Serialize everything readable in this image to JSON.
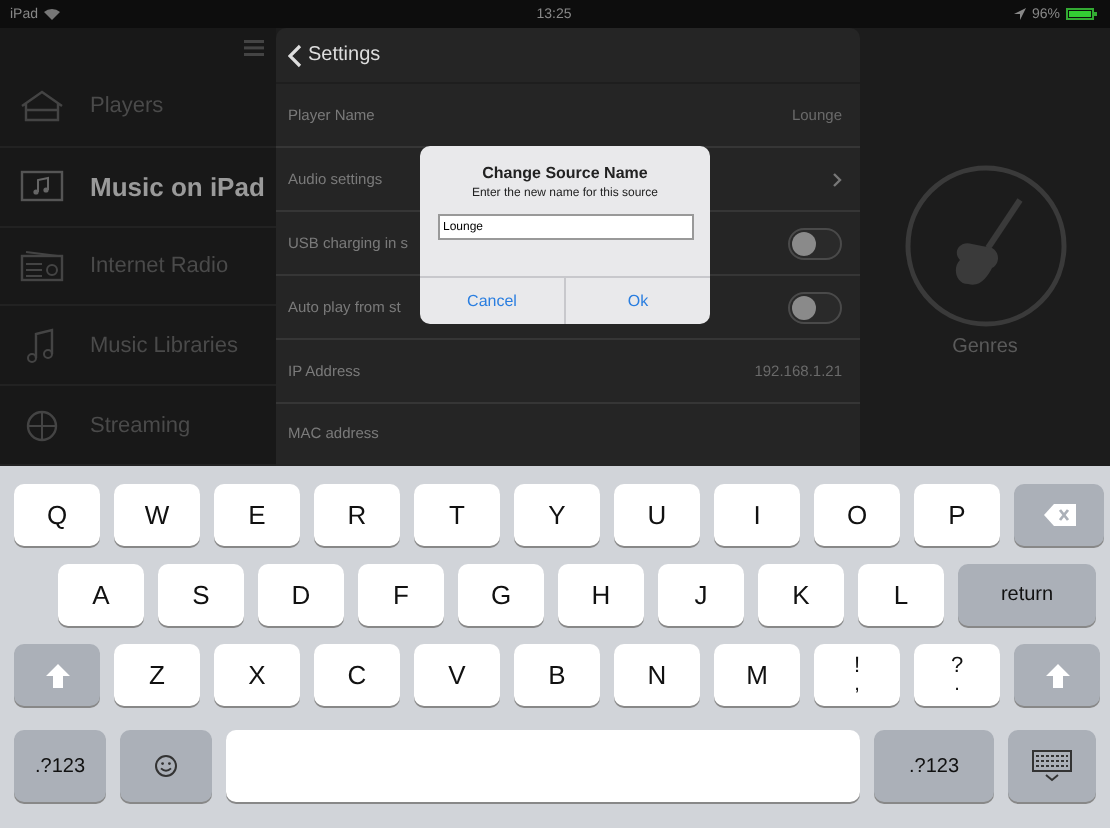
{
  "status_bar": {
    "device": "iPad",
    "time": "13:25",
    "battery": "96%"
  },
  "sidebar": {
    "items": [
      {
        "label": "Players",
        "selected": false
      },
      {
        "label": "Music on iPad",
        "selected": true
      },
      {
        "label": "Internet Radio",
        "selected": false
      },
      {
        "label": "Music Libraries",
        "selected": false
      },
      {
        "label": "Streaming",
        "selected": false
      }
    ]
  },
  "settings": {
    "back": "Settings",
    "rows": [
      {
        "kind": "value",
        "label": "Player Name",
        "value": "Lounge"
      },
      {
        "kind": "link",
        "label": "Audio settings"
      },
      {
        "kind": "toggle",
        "label": "USB charging in s",
        "on": false
      },
      {
        "kind": "toggle",
        "label": "Auto play from st",
        "on": false
      },
      {
        "kind": "value",
        "label": "IP Address",
        "value": "192.168.1.21"
      },
      {
        "kind": "value",
        "label": "MAC address"
      }
    ]
  },
  "browse": {
    "label": "Genres"
  },
  "dialog": {
    "title": "Change Source Name",
    "message": "Enter the new name for this source",
    "value": "Lounge",
    "buttons": [
      "Cancel",
      "Ok"
    ]
  },
  "keyboard": {
    "rows": [
      [
        {
          "kind": "letter",
          "label": "Q"
        },
        {
          "kind": "letter",
          "label": "W"
        },
        {
          "kind": "letter",
          "label": "E"
        },
        {
          "kind": "letter",
          "label": "R"
        },
        {
          "kind": "letter",
          "label": "T"
        },
        {
          "kind": "letter",
          "label": "Y"
        },
        {
          "kind": "letter",
          "label": "U"
        },
        {
          "kind": "letter",
          "label": "I"
        },
        {
          "kind": "letter",
          "label": "O"
        },
        {
          "kind": "letter",
          "label": "P"
        },
        {
          "kind": "delete"
        }
      ],
      [
        {
          "kind": "letter",
          "label": "A"
        },
        {
          "kind": "letter",
          "label": "S"
        },
        {
          "kind": "letter",
          "label": "D"
        },
        {
          "kind": "letter",
          "label": "F"
        },
        {
          "kind": "letter",
          "label": "G"
        },
        {
          "kind": "letter",
          "label": "H"
        },
        {
          "kind": "letter",
          "label": "J"
        },
        {
          "kind": "letter",
          "label": "K"
        },
        {
          "kind": "letter",
          "label": "L"
        },
        {
          "kind": "return",
          "label": "return"
        }
      ],
      [
        {
          "kind": "shift"
        },
        {
          "kind": "letter",
          "label": "Z"
        },
        {
          "kind": "letter",
          "label": "X"
        },
        {
          "kind": "letter",
          "label": "C"
        },
        {
          "kind": "letter",
          "label": "V"
        },
        {
          "kind": "letter",
          "label": "B"
        },
        {
          "kind": "letter",
          "label": "N"
        },
        {
          "kind": "letter",
          "label": "M"
        },
        {
          "kind": "punct",
          "label": "!",
          "sub": ","
        },
        {
          "kind": "punct",
          "label": "?",
          "sub": "."
        },
        {
          "kind": "shift"
        }
      ],
      [
        {
          "kind": "mode",
          "label": ".?123"
        },
        {
          "kind": "emoji"
        },
        {
          "kind": "space"
        },
        {
          "kind": "mode",
          "label": ".?123"
        },
        {
          "kind": "hide"
        }
      ]
    ]
  }
}
